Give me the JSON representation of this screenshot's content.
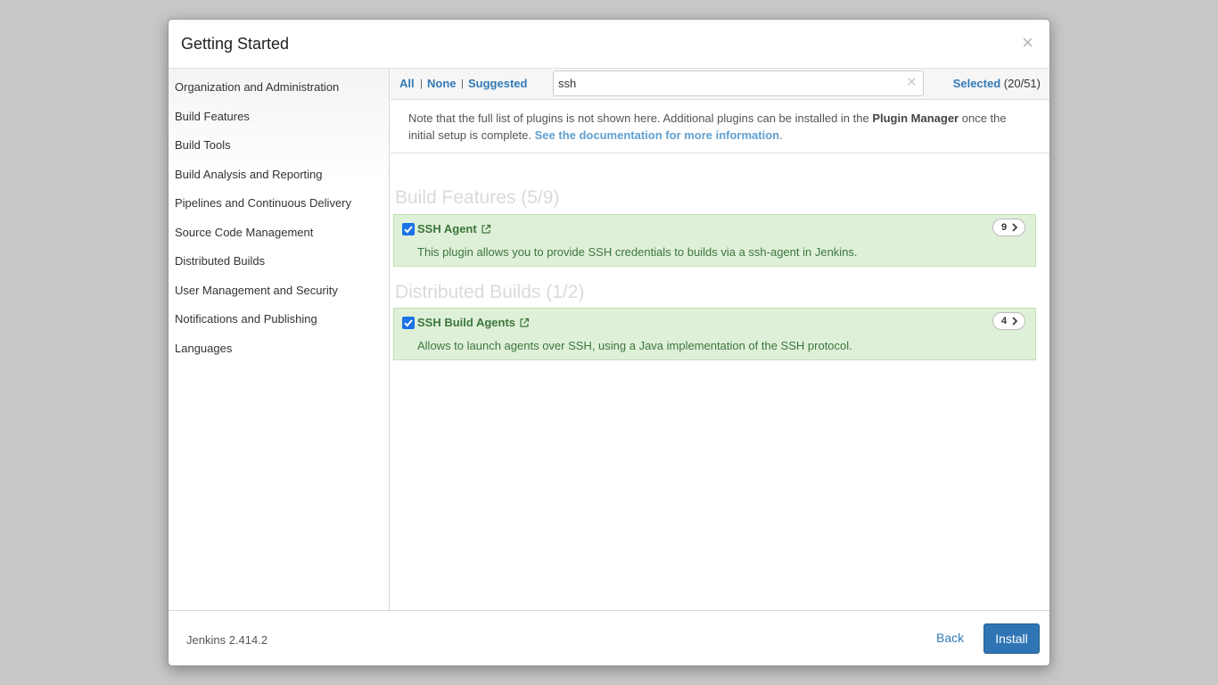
{
  "dialog": {
    "title": "Getting Started",
    "close_glyph": "×"
  },
  "sidebar": {
    "items": [
      {
        "label": "Organization and Administration"
      },
      {
        "label": "Build Features"
      },
      {
        "label": "Build Tools"
      },
      {
        "label": "Build Analysis and Reporting"
      },
      {
        "label": "Pipelines and Continuous Delivery"
      },
      {
        "label": "Source Code Management"
      },
      {
        "label": "Distributed Builds"
      },
      {
        "label": "User Management and Security"
      },
      {
        "label": "Notifications and Publishing"
      },
      {
        "label": "Languages"
      }
    ]
  },
  "toolbar": {
    "all_label": "All",
    "none_label": "None",
    "suggested_label": "Suggested",
    "separator": "|",
    "search_value": "ssh",
    "clear_glyph": "×",
    "selected_label": "Selected",
    "selected_count": "(20/51)"
  },
  "note": {
    "text_before": "Note that the full list of plugins is not shown here. Additional plugins can be installed in the ",
    "plugin_manager": "Plugin Manager",
    "text_after": " once the initial setup is complete. ",
    "doc_link": "See the documentation for more information",
    "period": "."
  },
  "categories": [
    {
      "heading": "Build Features (5/9)",
      "plugins": [
        {
          "name": "SSH Agent",
          "description": "This plugin allows you to provide SSH credentials to builds via a ssh-agent in Jenkins.",
          "dependencies": "9",
          "checked": true
        }
      ]
    },
    {
      "heading": "Distributed Builds (1/2)",
      "plugins": [
        {
          "name": "SSH Build Agents",
          "description": "Allows to launch agents over SSH, using a Java implementation of the SSH protocol.",
          "dependencies": "4",
          "checked": true
        }
      ]
    }
  ],
  "footer": {
    "version": "Jenkins 2.414.2",
    "back_label": "Back",
    "install_label": "Install"
  },
  "colors": {
    "link": "#337ab7",
    "plugin_bg": "#dff0d8",
    "plugin_text": "#3c763d",
    "install_bg": "#2f75b5",
    "overlay": "#c8c8c8"
  },
  "icons": [
    "close-icon",
    "clear-search-icon",
    "external-link-icon",
    "chevron-right-icon",
    "checkbox-checked-icon"
  ]
}
